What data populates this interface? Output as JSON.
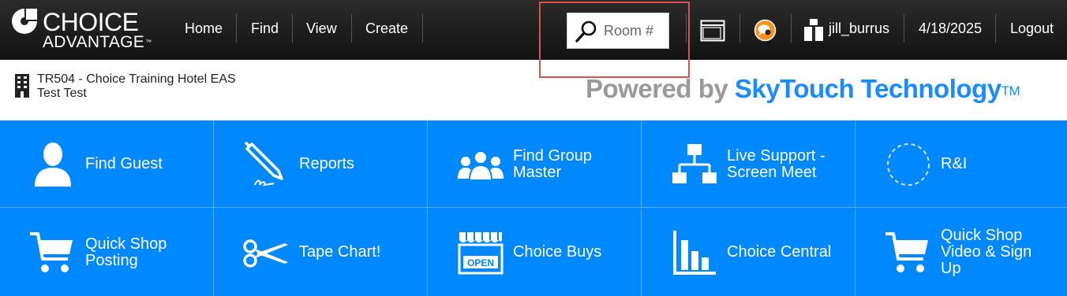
{
  "brand": {
    "line1": "CHOICE",
    "line2": "ADVANTAGE",
    "tm": "™"
  },
  "nav": {
    "items": [
      "Home",
      "Find",
      "View",
      "Create"
    ]
  },
  "room_search": {
    "placeholder": "Room #"
  },
  "header_icons": [
    "window-icon",
    "support-chat-icon"
  ],
  "user": {
    "name": "jill_burrus",
    "date": "4/18/2025",
    "logout": "Logout"
  },
  "hotel": {
    "line1": "TR504 - Choice Training Hotel EAS",
    "line2": "Test Test"
  },
  "powered_by": {
    "prefix": "Powered by",
    "brand": "SkyTouch Technology",
    "tm": "TM"
  },
  "colors": {
    "tile_blue": "#0088ff",
    "brand_blue": "#1a8cff",
    "highlight_red": "#d9534f"
  },
  "tiles": [
    {
      "label": "Find Guest",
      "icon": "person-icon"
    },
    {
      "label": "Reports",
      "icon": "pen-signature-icon"
    },
    {
      "label": "Find Group Master",
      "icon": "group-icon"
    },
    {
      "label": "Live Support - Screen Meet",
      "icon": "org-chart-icon"
    },
    {
      "label": "R&I",
      "icon": "dashed-circle-icon"
    },
    {
      "label": "Quick Shop Posting",
      "icon": "cart-icon"
    },
    {
      "label": "Tape Chart!",
      "icon": "scissors-icon"
    },
    {
      "label": "Choice Buys",
      "icon": "open-store-icon"
    },
    {
      "label": "Choice Central",
      "icon": "bar-chart-icon"
    },
    {
      "label": "Quick Shop Video & Sign Up",
      "icon": "cart-icon"
    }
  ]
}
